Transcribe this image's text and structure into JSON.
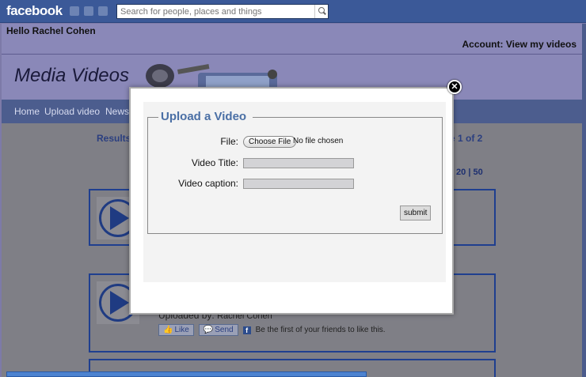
{
  "topbar": {
    "logo": "facebook",
    "search_placeholder": "Search for people, places and things"
  },
  "header": {
    "greeting": "Hello Rachel Cohen",
    "account_link": "Account: View my videos",
    "banner_title": "Media Videos"
  },
  "nav": {
    "items": [
      {
        "label": "Home"
      },
      {
        "label": "Upload video"
      },
      {
        "label": "News"
      }
    ]
  },
  "listing": {
    "results_label": "Results",
    "page_label": "e 1 of 2",
    "per_page": [
      "20",
      "50"
    ],
    "per_page_separator": "|",
    "item": {
      "uploaded_by_label": "Uploaded by:",
      "uploaded_by_name": "Rachel Cohen",
      "like_label": "Like",
      "send_label": "Send",
      "social_text": "Be the first of your friends to like this."
    }
  },
  "modal": {
    "title": "Upload a Video",
    "file_label": "File:",
    "choose_file_label": "Choose File",
    "no_file_text": "No file chosen",
    "video_title_label": "Video Title:",
    "video_caption_label": "Video caption:",
    "video_title_value": "",
    "video_caption_value": "",
    "submit_label": "submit"
  },
  "colors": {
    "facebook_blue": "#3b5998",
    "legend_blue": "#4a6fa5",
    "card_border": "#1f3f8f"
  }
}
